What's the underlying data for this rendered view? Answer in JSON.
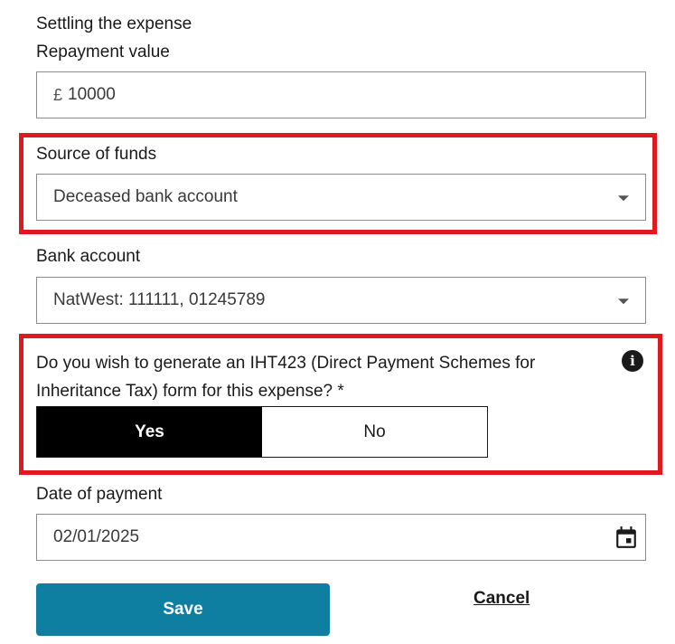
{
  "section_title": "Settling the expense",
  "repayment": {
    "label": "Repayment value",
    "currency_symbol": "£",
    "value": "10000"
  },
  "source_of_funds": {
    "label": "Source of funds",
    "selected": "Deceased bank account"
  },
  "bank_account": {
    "label": "Bank account",
    "selected": "NatWest: 111111, 01245789"
  },
  "iht423": {
    "question": "Do you wish to generate an IHT423 (Direct Payment Schemes for Inheritance Tax) form for this expense? *",
    "info_icon": "info-icon",
    "options": [
      "Yes",
      "No"
    ],
    "selected": "Yes"
  },
  "date_of_payment": {
    "label": "Date of payment",
    "value": "02/01/2025",
    "icon": "calendar-icon"
  },
  "actions": {
    "save_label": "Save",
    "cancel_label": "Cancel"
  },
  "colors": {
    "highlight": "#e0191f",
    "save_button": "#0e7fa1",
    "toggle_selected": "#000000"
  }
}
